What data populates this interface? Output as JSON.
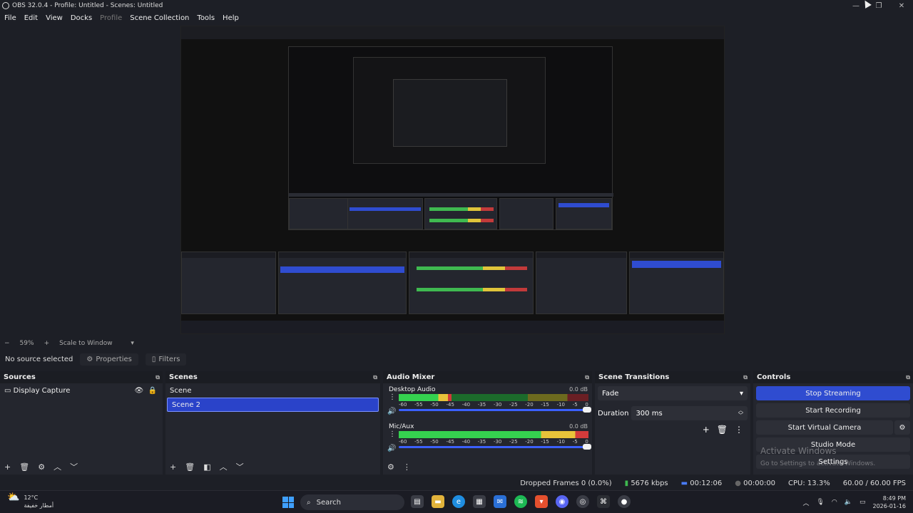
{
  "window": {
    "title": "OBS 32.0.4 - Profile: Untitled - Scenes: Untitled",
    "controls": [
      "—",
      "❐",
      "✕"
    ]
  },
  "menu": [
    "File",
    "Edit",
    "View",
    "Docks",
    "Profile",
    "Scene Collection",
    "Tools",
    "Help"
  ],
  "zoom": {
    "minus": "−",
    "value": "59%",
    "plus": "+",
    "mode": "Scale to Window"
  },
  "source_toolbar": {
    "status": "No source selected",
    "properties": "Properties",
    "filters": "Filters"
  },
  "sources": {
    "header": "Sources",
    "items": [
      {
        "name": "Display Capture"
      }
    ]
  },
  "scenes": {
    "header": "Scenes",
    "items": [
      {
        "name": "Scene",
        "selected": false
      },
      {
        "name": "Scene 2",
        "selected": true
      }
    ]
  },
  "mixer": {
    "header": "Audio Mixer",
    "ticks": [
      "-60",
      "-55",
      "-50",
      "-45",
      "-40",
      "-35",
      "-30",
      "-25",
      "-20",
      "-15",
      "-10",
      "-5",
      "0"
    ],
    "tracks": [
      {
        "name": "Desktop Audio",
        "db": "0.0 dB",
        "level": 0.28
      },
      {
        "name": "Mic/Aux",
        "db": "0.0 dB",
        "level": 1.0
      }
    ]
  },
  "transitions": {
    "header": "Scene Transitions",
    "type": "Fade",
    "duration_label": "Duration",
    "duration_value": "300 ms"
  },
  "controls": {
    "header": "Controls",
    "stop_streaming": "Stop Streaming",
    "start_recording": "Start Recording",
    "start_virtual_camera": "Start Virtual Camera",
    "studio_mode": "Studio Mode",
    "settings": "Settings"
  },
  "watermark": {
    "line1": "Activate Windows",
    "line2": "Go to Settings to activate Windows."
  },
  "status": {
    "dropped": "Dropped Frames 0 (0.0%)",
    "bitrate": "5676 kbps",
    "stream_time": "00:12:06",
    "rec_time": "00:00:00",
    "cpu": "CPU: 13.3%",
    "fps": "60.00 / 60.00 FPS"
  },
  "taskbar": {
    "temp": "12°C",
    "weather": "أمطار خفيفة",
    "search": "Search",
    "time": "8:49 PM",
    "date": "2026-01-16"
  },
  "colors": {
    "accent": "#2f4cd0",
    "panel": "#24262e",
    "background": "#1d1f26"
  }
}
